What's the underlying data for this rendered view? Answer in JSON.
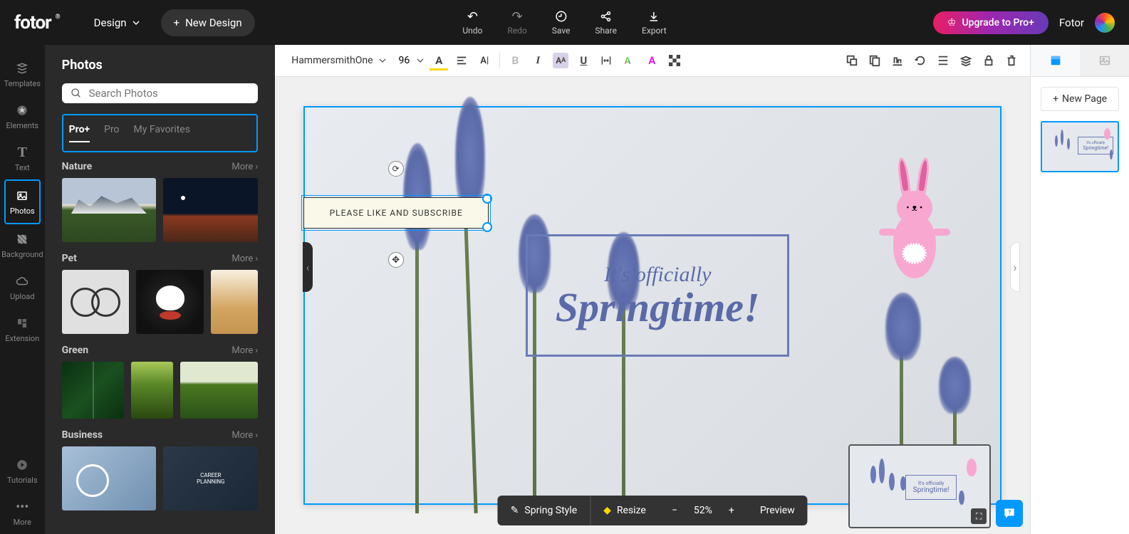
{
  "header": {
    "logo": "fotor",
    "design_dropdown": "Design",
    "new_design": "New Design",
    "actions": {
      "undo": "Undo",
      "redo": "Redo",
      "save": "Save",
      "share": "Share",
      "export": "Export"
    },
    "upgrade": "Upgrade to Pro+",
    "user": "Fotor"
  },
  "rail": {
    "templates": "Templates",
    "elements": "Elements",
    "text": "Text",
    "photos": "Photos",
    "background": "Background",
    "upload": "Upload",
    "extension": "Extension",
    "tutorials": "Tutorials",
    "more": "More"
  },
  "panel": {
    "title": "Photos",
    "search_placeholder": "Search Photos",
    "tabs": {
      "pro_plus": "Pro+",
      "pro": "Pro",
      "favorites": "My Favorites"
    },
    "more": "More",
    "categories": {
      "nature": "Nature",
      "pet": "Pet",
      "green": "Green",
      "business": "Business"
    }
  },
  "toolbar": {
    "font": "HammersmithOne",
    "size": "96"
  },
  "canvas": {
    "banner_text": "PLEASE LIKE AND SUBSCRIBE",
    "text1": "It's officially",
    "text2": "Springtime!"
  },
  "bottombar": {
    "style": "Spring Style",
    "resize": "Resize",
    "zoom": "52%",
    "preview": "Preview"
  },
  "right": {
    "new_page": "New Page"
  }
}
